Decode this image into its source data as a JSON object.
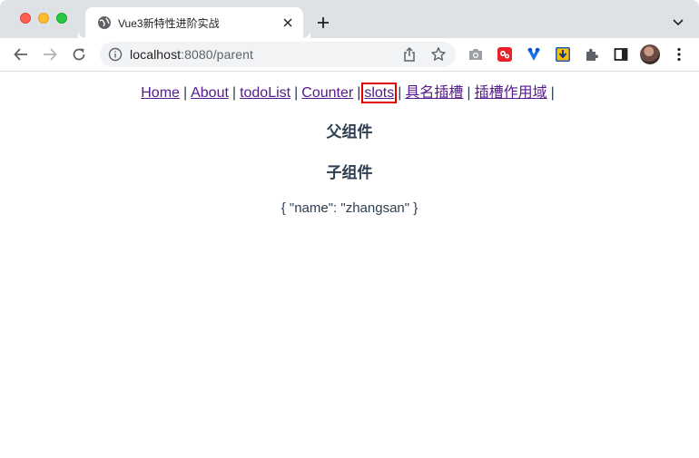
{
  "browser": {
    "tab_title": "Vue3新特性进阶实战",
    "url_host": "localhost",
    "url_rest": ":8080/parent",
    "colors": {
      "tabstrip": "#dee1e6",
      "omnibox": "#f1f3f4",
      "highlight": "#e00000",
      "link": "#551a8b",
      "text": "#2c3e50"
    },
    "icons": [
      "globe-icon",
      "close-icon",
      "plus-icon",
      "chevron-down-icon",
      "back-arrow-icon",
      "forward-arrow-icon",
      "reload-icon",
      "info-icon",
      "share-icon",
      "star-icon",
      "camera-icon",
      "red-extension-icon",
      "blue-extension-icon",
      "download-extension-icon",
      "puzzle-icon",
      "sidebar-icon",
      "avatar",
      "menu-dots-icon"
    ]
  },
  "nav": {
    "links": [
      "Home",
      "About",
      "todoList",
      "Counter",
      "slots",
      "具名插槽",
      "插槽作用域"
    ],
    "separator": "|"
  },
  "page": {
    "parent_heading": "父组件",
    "child_heading": "子组件",
    "json_output": "{ \"name\": \"zhangsan\" }"
  }
}
